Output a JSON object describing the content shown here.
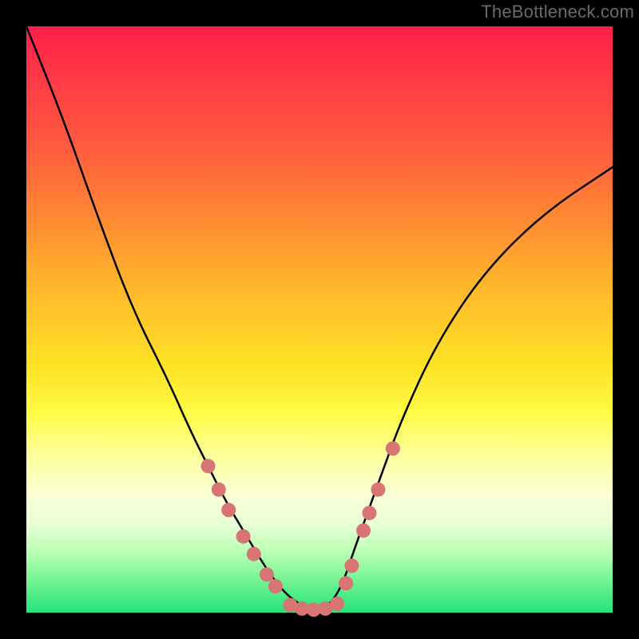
{
  "watermark": "TheBottleneck.com",
  "colors": {
    "frame": "#000000",
    "curve": "#000000",
    "marker_fill": "#d97474",
    "marker_stroke": "#b85a5a",
    "gradient_stops": [
      "#ff1f4a",
      "#ff3747",
      "#ff5a3f",
      "#ff8a33",
      "#ffb92b",
      "#ffe326",
      "#fffb45",
      "#fdff9a",
      "#fbffd6",
      "#e7ffd6",
      "#b6ffb0",
      "#6cf28f",
      "#24e37a"
    ]
  },
  "chart_data": {
    "type": "line",
    "title": "",
    "xlabel": "",
    "ylabel": "",
    "xlim": [
      0,
      100
    ],
    "ylim": [
      0,
      100
    ],
    "grid": false,
    "legend": false,
    "series": [
      {
        "name": "bottleneck-curve",
        "x": [
          0,
          6,
          12,
          18,
          24,
          28,
          31,
          34,
          37,
          40,
          42,
          44,
          46,
          48,
          50,
          52,
          54,
          56,
          60,
          64,
          70,
          78,
          88,
          100
        ],
        "y": [
          100,
          85,
          68,
          52,
          40,
          31,
          25,
          19,
          14,
          9,
          6,
          3.5,
          1.8,
          0.8,
          0.5,
          1.6,
          5,
          11,
          22,
          33,
          46,
          58,
          68,
          76
        ]
      }
    ],
    "markers": [
      {
        "name": "left-marker-1",
        "x": 31,
        "y": 25
      },
      {
        "name": "left-marker-2",
        "x": 32.8,
        "y": 21
      },
      {
        "name": "left-marker-3",
        "x": 34.5,
        "y": 17.5
      },
      {
        "name": "left-marker-4",
        "x": 37,
        "y": 13
      },
      {
        "name": "left-marker-5",
        "x": 38.8,
        "y": 10
      },
      {
        "name": "left-marker-6",
        "x": 41,
        "y": 6.5
      },
      {
        "name": "left-marker-7",
        "x": 42.5,
        "y": 4.5
      },
      {
        "name": "bottom-marker-1",
        "x": 45,
        "y": 1.3
      },
      {
        "name": "bottom-marker-2",
        "x": 47,
        "y": 0.7
      },
      {
        "name": "bottom-marker-3",
        "x": 49,
        "y": 0.5
      },
      {
        "name": "bottom-marker-4",
        "x": 51,
        "y": 0.7
      },
      {
        "name": "bottom-marker-5",
        "x": 53,
        "y": 1.5
      },
      {
        "name": "right-marker-1",
        "x": 54.5,
        "y": 5
      },
      {
        "name": "right-marker-2",
        "x": 55.5,
        "y": 8
      },
      {
        "name": "right-marker-3",
        "x": 57.5,
        "y": 14
      },
      {
        "name": "right-marker-4",
        "x": 58.5,
        "y": 17
      },
      {
        "name": "right-marker-5",
        "x": 60,
        "y": 21
      },
      {
        "name": "right-marker-6",
        "x": 62.5,
        "y": 28
      }
    ],
    "marker_radius_px": 9
  }
}
